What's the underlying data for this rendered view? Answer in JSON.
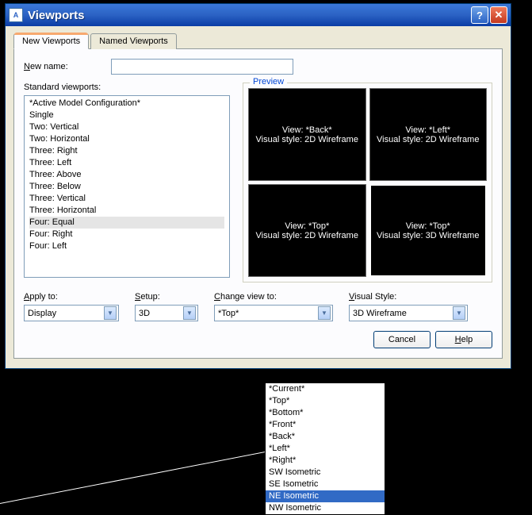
{
  "titlebar": {
    "title": "Viewports"
  },
  "tabs": {
    "new": "New Viewports",
    "named": "Named Viewports"
  },
  "newname_label": "New name:",
  "newname_value": "",
  "std_label": "Standard viewports:",
  "std_items": [
    "*Active Model Configuration*",
    "Single",
    "Two:   Vertical",
    "Two:   Horizontal",
    "Three: Right",
    "Three: Left",
    "Three: Above",
    "Three: Below",
    "Three: Vertical",
    "Three: Horizontal",
    "Four:  Equal",
    "Four:  Right",
    "Four:  Left"
  ],
  "std_selected_index": 10,
  "preview_label": "Preview",
  "previews": [
    {
      "view": "View: *Back*",
      "style": "Visual style: 2D Wireframe",
      "selected": false
    },
    {
      "view": "View: *Left*",
      "style": "Visual style: 2D Wireframe",
      "selected": false
    },
    {
      "view": "View: *Top*",
      "style": "Visual style: 2D Wireframe",
      "selected": false
    },
    {
      "view": "View: *Top*",
      "style": "Visual style: 3D Wireframe",
      "selected": true
    }
  ],
  "apply_label": "Apply to:",
  "apply_value": "Display",
  "setup_label": "Setup:",
  "setup_value": "3D",
  "change_label": "Change view to:",
  "change_value": "*Top*",
  "visual_label": "Visual Style:",
  "visual_value": "3D Wireframe",
  "change_options": [
    "*Current*",
    "*Top*",
    "*Bottom*",
    "*Front*",
    "*Back*",
    "*Left*",
    "*Right*",
    "SW Isometric",
    "SE Isometric",
    "NE Isometric",
    "NW Isometric"
  ],
  "change_highlight_index": 9,
  "buttons": {
    "cancel": "Cancel",
    "help": "Help"
  }
}
